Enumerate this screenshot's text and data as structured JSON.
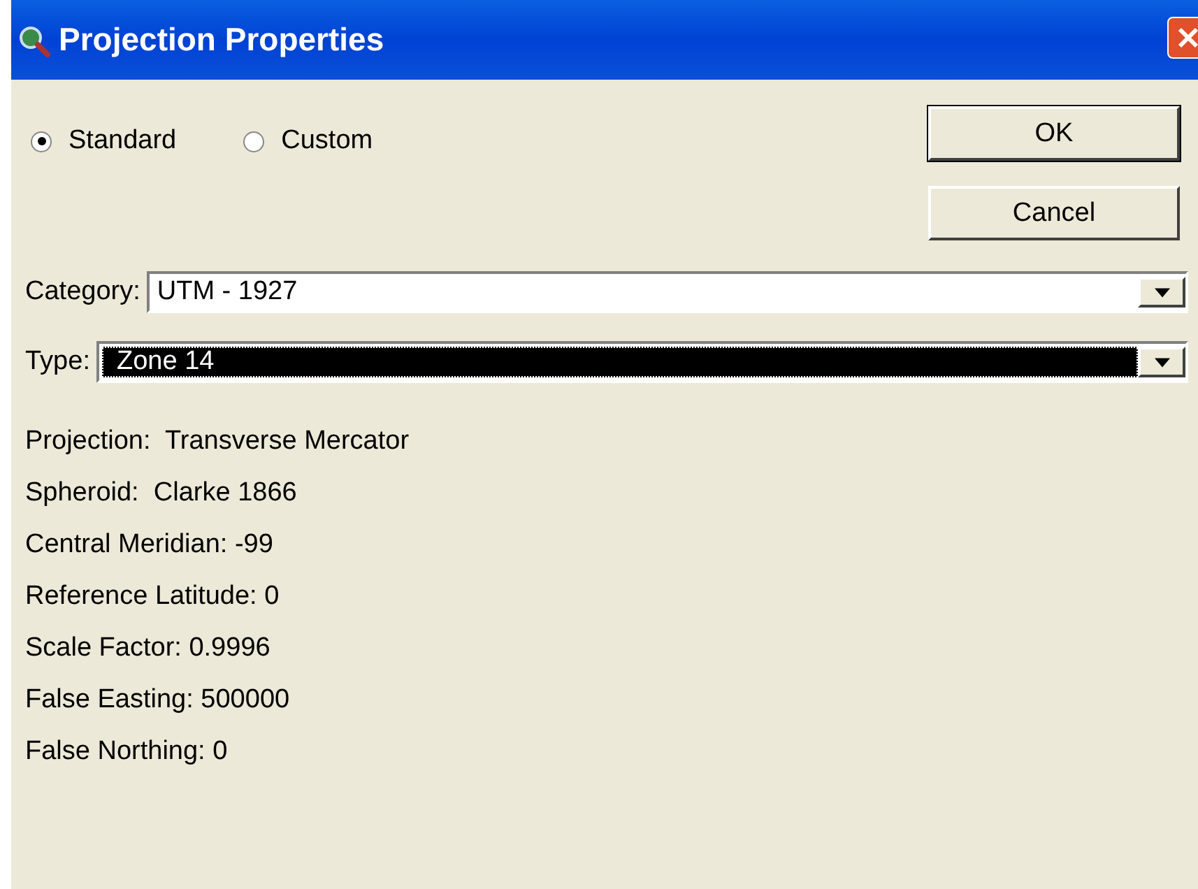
{
  "window": {
    "title": "Projection Properties"
  },
  "mode_options": [
    {
      "label": "Standard",
      "selected": true
    },
    {
      "label": "Custom",
      "selected": false
    }
  ],
  "buttons": [
    {
      "label": "OK",
      "default": true
    },
    {
      "label": "Cancel",
      "default": false
    }
  ],
  "dropdowns": [
    {
      "label": "Category:",
      "value": "UTM - 1927",
      "highlighted": false
    },
    {
      "label": "Type:",
      "value": "Zone 14",
      "highlighted": true
    }
  ],
  "details": [
    "Projection:  Transverse Mercator",
    "Spheroid:  Clarke 1866",
    "Central Meridian: -99",
    "Reference Latitude: 0",
    "Scale Factor: 0.9996",
    "False Easting: 500000",
    "False Northing: 0"
  ]
}
